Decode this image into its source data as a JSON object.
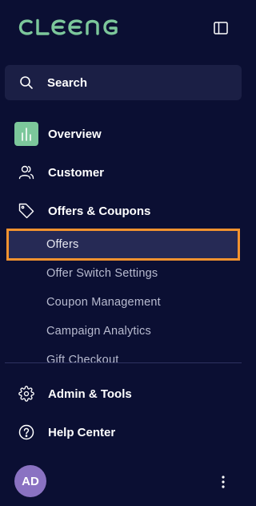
{
  "brand": {
    "logo_text": "CLEENG",
    "accent_color": "#7cc79b",
    "highlight_color": "#f2922f"
  },
  "search": {
    "label": "Search",
    "icon": "search-icon"
  },
  "nav": {
    "overview": {
      "label": "Overview",
      "icon": "bar-chart-icon"
    },
    "customer": {
      "label": "Customer",
      "icon": "users-icon"
    },
    "offers_coupons": {
      "label": "Offers & Coupons",
      "icon": "tag-icon",
      "items": [
        {
          "label": "Offers",
          "active": true
        },
        {
          "label": "Offer Switch Settings"
        },
        {
          "label": "Coupon Management"
        },
        {
          "label": "Campaign Analytics"
        },
        {
          "label": "Gift Checkout"
        }
      ]
    },
    "admin_tools": {
      "label": "Admin & Tools",
      "icon": "gear-icon"
    },
    "help_center": {
      "label": "Help Center",
      "icon": "help-circle-icon"
    }
  },
  "user": {
    "initials": "AD",
    "avatar_color": "#8a72c2"
  }
}
